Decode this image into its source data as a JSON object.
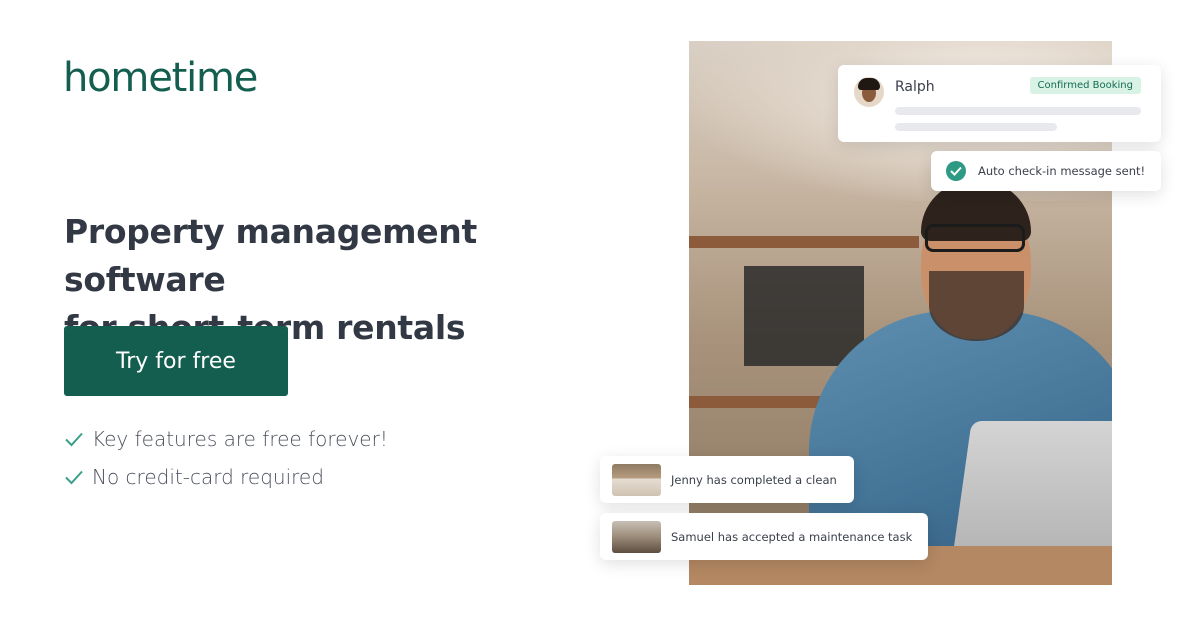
{
  "brand": {
    "logo_text": "hometime",
    "color": "#135e4f"
  },
  "hero": {
    "headline_line1": "Property management software",
    "headline_line2": "for short-term rentals",
    "cta_label": "Try for free",
    "features": [
      {
        "icon": "check-icon",
        "label": "Key features are free forever!"
      },
      {
        "icon": "check-icon",
        "label": "No credit-card required"
      }
    ]
  },
  "notifications": {
    "booking": {
      "guest_name": "Ralph",
      "status_badge": "Confirmed Booking"
    },
    "checkin": {
      "icon": "check-circle-icon",
      "message": "Auto check-in message sent!"
    },
    "tasks": [
      {
        "thumb": "bedroom-thumbnail",
        "message": "Jenny has completed a clean"
      },
      {
        "thumb": "living-room-thumbnail",
        "message": "Samuel has accepted a maintenance task"
      }
    ]
  },
  "colors": {
    "accent": "#135e4f",
    "badge_bg": "#d9f2e6",
    "success": "#2e9a83",
    "check": "#3aa087"
  }
}
